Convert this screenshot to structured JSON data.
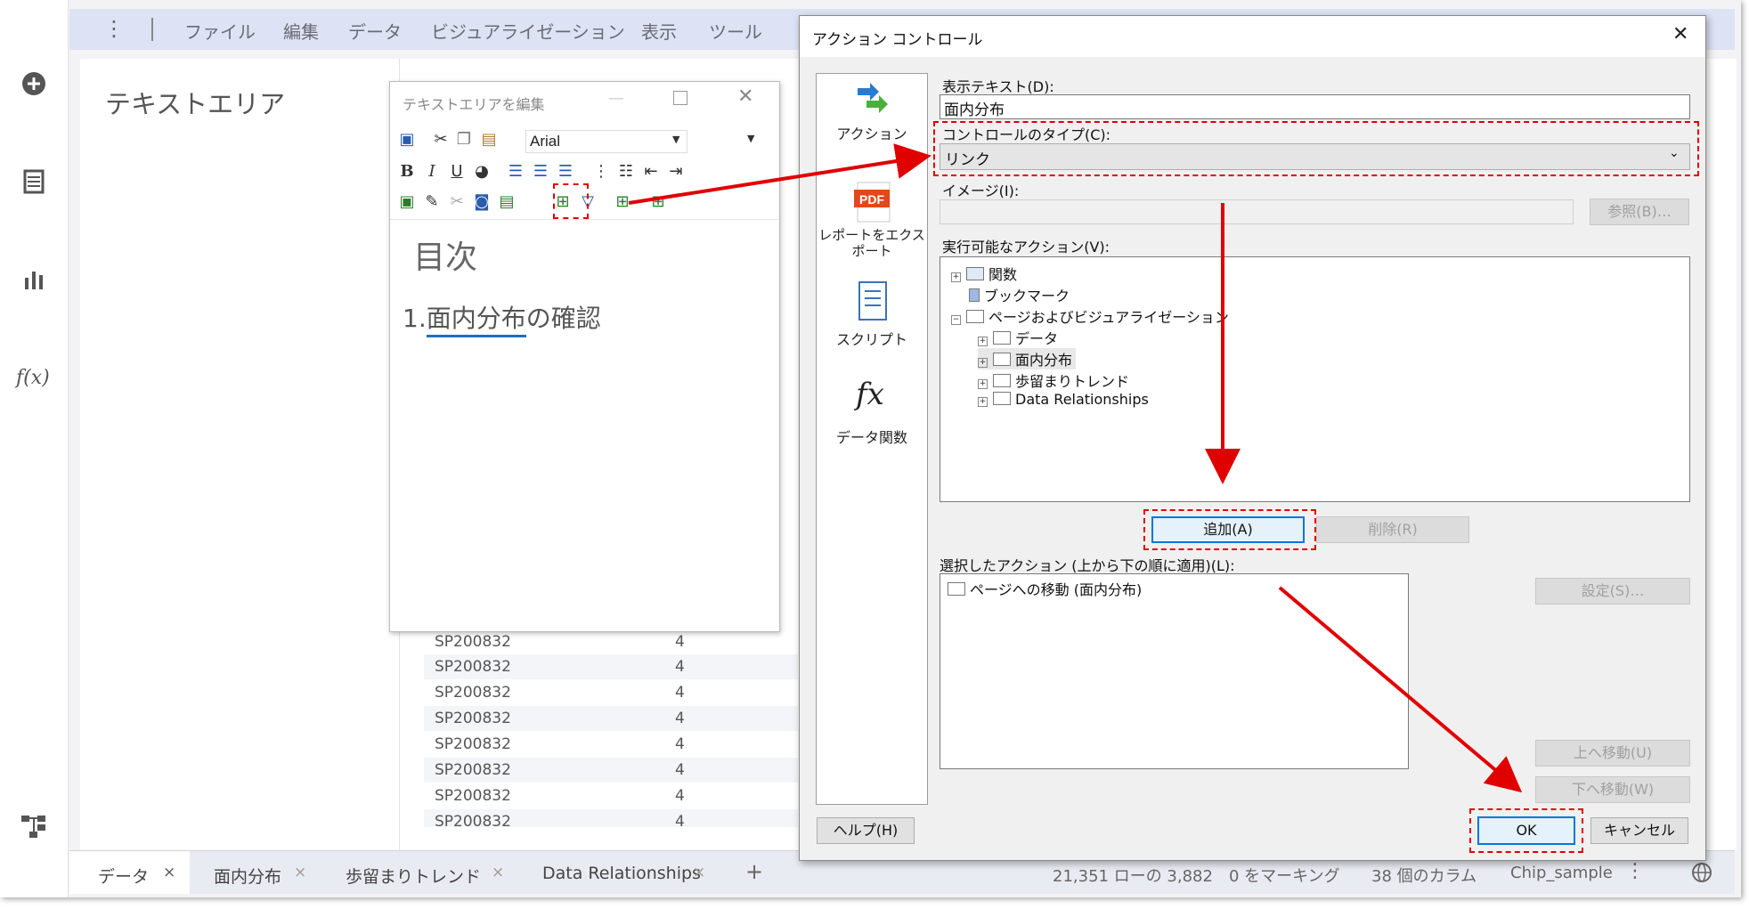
{
  "menu": [
    "ファイル",
    "編集",
    "データ",
    "ビジュアライゼーション",
    "表示",
    "ツール"
  ],
  "canvas": {
    "title": "テキストエリア"
  },
  "table_rows": [
    [
      "SP200832",
      "4"
    ],
    [
      "SP200832",
      "4"
    ],
    [
      "SP200832",
      "4"
    ],
    [
      "SP200832",
      "4"
    ],
    [
      "SP200832",
      "4"
    ],
    [
      "SP200832",
      "4"
    ],
    [
      "SP200832",
      "4"
    ],
    [
      "SP200832",
      "4"
    ]
  ],
  "tabs": {
    "t1": "データ",
    "t2": "面内分布",
    "t3": "歩留まりトレンド",
    "t4": "Data Relationships",
    "close": "×",
    "add": "+"
  },
  "status": {
    "rows": "21,351 ローの 3,882",
    "marking": "0 をマーキング",
    "columns": "38 個のカラム",
    "source": "Chip_sample"
  },
  "editor": {
    "title": "テキストエリアを編集",
    "font": "Arial",
    "heading": "目次",
    "item_number": "1.",
    "item_link": "面内分布",
    "item_suffix": "の確認"
  },
  "dialog": {
    "title": "アクション コントロール",
    "left_items": [
      "アクション",
      "レポートをエクスポート",
      "スクリプト",
      "データ関数"
    ],
    "display_text_label": "表示テキスト(D):",
    "display_text_value": "面内分布",
    "control_type_label": "コントロールのタイプ(C):",
    "control_type_value": "リンク",
    "image_label": "イメージ(I):",
    "browse_button": "参照(B)…",
    "actions_label": "実行可能なアクション(V):",
    "tree": {
      "functions": "関数",
      "bookmark": "ブックマーク",
      "pages": "ページおよびビジュアライゼーション",
      "page_items": [
        "データ",
        "面内分布",
        "歩留まりトレンド",
        "Data Relationships"
      ]
    },
    "add_button": "追加(A)",
    "delete_button": "削除(R)",
    "selected_label": "選択したアクション (上から下の順に適用)(L):",
    "selected_items": [
      "ページへの移動 (面内分布)"
    ],
    "settings_button": "設定(S)…",
    "move_up_button": "上へ移動(U)",
    "move_down_button": "下へ移動(W)",
    "help_button": "ヘルプ(H)",
    "ok_button": "OK",
    "cancel_button": "キャンセル"
  },
  "colors": {
    "annotation_red": "#e00000",
    "menu_bar": "#dde3f4",
    "selection_blue": "#0078d7"
  }
}
